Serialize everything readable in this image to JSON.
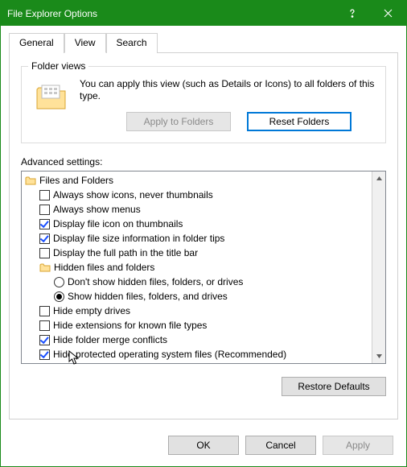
{
  "window": {
    "title": "File Explorer Options"
  },
  "tabs": {
    "general": "General",
    "view": "View",
    "search": "Search"
  },
  "folder_views": {
    "legend": "Folder views",
    "text": "You can apply this view (such as Details or Icons) to all folders of this type.",
    "apply": "Apply to Folders",
    "reset": "Reset Folders"
  },
  "advanced": {
    "label": "Advanced settings:",
    "rows": [
      {
        "kind": "folder",
        "indent": 0,
        "text": "Files and Folders"
      },
      {
        "kind": "check",
        "indent": 1,
        "checked": false,
        "text": "Always show icons, never thumbnails"
      },
      {
        "kind": "check",
        "indent": 1,
        "checked": false,
        "text": "Always show menus"
      },
      {
        "kind": "check",
        "indent": 1,
        "checked": true,
        "text": "Display file icon on thumbnails"
      },
      {
        "kind": "check",
        "indent": 1,
        "checked": true,
        "text": "Display file size information in folder tips"
      },
      {
        "kind": "check",
        "indent": 1,
        "checked": false,
        "text": "Display the full path in the title bar"
      },
      {
        "kind": "folder",
        "indent": 1,
        "text": "Hidden files and folders"
      },
      {
        "kind": "radio",
        "indent": 2,
        "selected": false,
        "text": "Don't show hidden files, folders, or drives"
      },
      {
        "kind": "radio",
        "indent": 2,
        "selected": true,
        "text": "Show hidden files, folders, and drives"
      },
      {
        "kind": "check",
        "indent": 1,
        "checked": false,
        "text": "Hide empty drives"
      },
      {
        "kind": "check",
        "indent": 1,
        "checked": false,
        "text": "Hide extensions for known file types"
      },
      {
        "kind": "check",
        "indent": 1,
        "checked": true,
        "text": "Hide folder merge conflicts"
      },
      {
        "kind": "check",
        "indent": 1,
        "checked": true,
        "text": "Hide protected operating system files (Recommended)"
      }
    ]
  },
  "buttons": {
    "restore": "Restore Defaults",
    "ok": "OK",
    "cancel": "Cancel",
    "apply": "Apply"
  }
}
